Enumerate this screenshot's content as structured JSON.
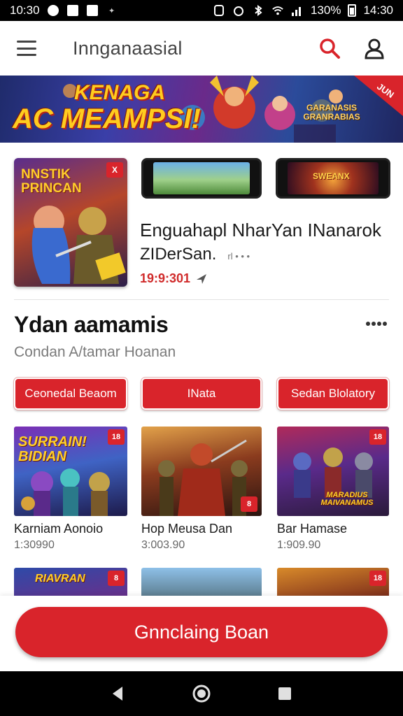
{
  "status_bar": {
    "time_left": "10:30",
    "battery": "130%",
    "time_right": "14:30"
  },
  "app_bar": {
    "title": "Innganaasial"
  },
  "banner": {
    "line1": "KENAGA",
    "line2": "AC MEAMPSI!",
    "logo_text": "GARANASIS GRANRABIAS",
    "tag": "JUN"
  },
  "featured": {
    "main_title": "NNSTIK PRINCAN",
    "main_badge": "X",
    "thumb2_title": "SWEANX",
    "title": "Enguahapl NharYan INanarok",
    "subtitle": "ZIDerSan.",
    "meta": "rl • • •",
    "price": "19:9:301"
  },
  "section": {
    "title": "Ydan aamamis",
    "subtitle": "Condan A/tamar Hoanan"
  },
  "chips": [
    {
      "label": "Ceonedal Beaom"
    },
    {
      "label": "INata"
    },
    {
      "label": "Sedan Blolatory"
    }
  ],
  "games": [
    {
      "name": "Karniam Aonoio",
      "price": "1:30990",
      "img_text": "SURRAIN! BIDIAN",
      "badge": "18"
    },
    {
      "name": "Hop Meusa Dan",
      "price": "3:003.90",
      "img_text": "",
      "badge": "8"
    },
    {
      "name": "Bar Hamase",
      "price": "1:909.90",
      "img_text": "MARADIUS MAIVANAMUS",
      "badge": "18"
    }
  ],
  "row2": [
    {
      "img_text": "RIAVRAN",
      "badge": "8"
    },
    {
      "img_text": "",
      "badge": ""
    },
    {
      "img_text": "",
      "badge": "18"
    }
  ],
  "cta": {
    "label": "Gnnclaing Boan"
  },
  "colors": {
    "accent": "#d9242b",
    "text": "#1b1b1b",
    "muted": "#7b7b7b"
  }
}
